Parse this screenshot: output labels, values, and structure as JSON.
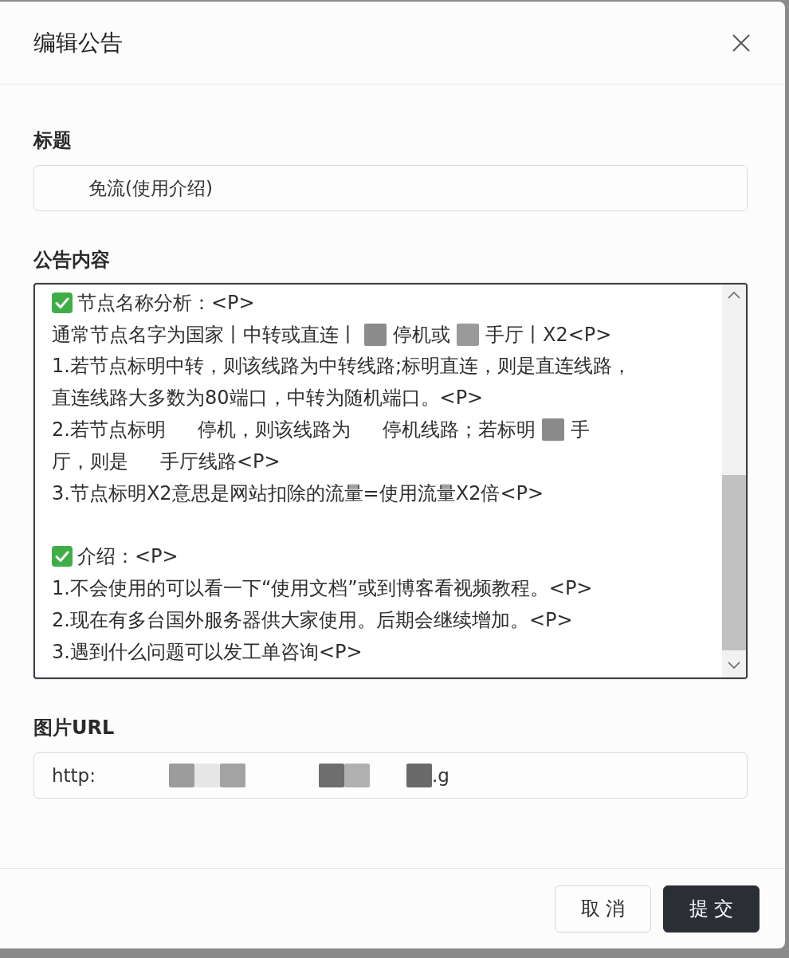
{
  "dialog": {
    "title": "编辑公告"
  },
  "fields": [
    {
      "kind": "input",
      "label": "标题",
      "segments": [
        {
          "kind": "gap"
        },
        {
          "kind": "text",
          "text": "免流(使用介绍)"
        }
      ]
    },
    {
      "kind": "textarea",
      "label": "公告内容",
      "focused": true,
      "lines": [
        {
          "kind": "heading",
          "segments": [
            {
              "kind": "text",
              "text": "节点名称分析：<P>"
            }
          ]
        },
        {
          "kind": "text",
          "segments": [
            {
              "kind": "text",
              "text": "通常节点名字为国家丨中转或直连丨"
            },
            {
              "kind": "redacted",
              "color": "#8c8c8c"
            },
            {
              "kind": "text",
              "text": "停机或"
            },
            {
              "kind": "redacted",
              "color": "#9a9a9a"
            },
            {
              "kind": "text",
              "text": "手厅丨X2<P>"
            }
          ]
        },
        {
          "kind": "text",
          "segments": [
            {
              "kind": "text",
              "text": "1.若节点标明中转，则该线路为中转线路;标明直连，则是直连线路，"
            }
          ]
        },
        {
          "kind": "text",
          "segments": [
            {
              "kind": "text",
              "text": "直连线路大多数为80端口，中转为随机端口。<P>"
            }
          ]
        },
        {
          "kind": "text",
          "segments": [
            {
              "kind": "text",
              "text": "2.若节点标明"
            },
            {
              "kind": "gap"
            },
            {
              "kind": "text",
              "text": "停机，则该线路为"
            },
            {
              "kind": "gap"
            },
            {
              "kind": "text",
              "text": "停机线路；若标明"
            },
            {
              "kind": "redacted",
              "color": "#8a8a8a"
            },
            {
              "kind": "text",
              "text": "手"
            }
          ]
        },
        {
          "kind": "text",
          "segments": [
            {
              "kind": "text",
              "text": "厅，则是"
            },
            {
              "kind": "gap"
            },
            {
              "kind": "text",
              "text": "手厅线路<P>"
            }
          ]
        },
        {
          "kind": "text",
          "segments": [
            {
              "kind": "text",
              "text": "3.节点标明X2意思是网站扣除的流量=使用流量X2倍<P>"
            }
          ]
        },
        {
          "kind": "blank"
        },
        {
          "kind": "heading",
          "segments": [
            {
              "kind": "text",
              "text": "介绍：<P>"
            }
          ]
        },
        {
          "kind": "text",
          "segments": [
            {
              "kind": "text",
              "text": "1.不会使用的可以看一下“使用文档”或到博客看视频教程。<P>"
            }
          ]
        },
        {
          "kind": "text",
          "segments": [
            {
              "kind": "text",
              "text": "2.现在有多台国外服务器供大家使用。后期会继续增加。<P>"
            }
          ]
        },
        {
          "kind": "text",
          "segments": [
            {
              "kind": "text",
              "text": "3.遇到什么问题可以发工单咨询<P>"
            }
          ]
        }
      ]
    },
    {
      "kind": "input",
      "label": "图片URL",
      "segments": [
        {
          "kind": "text",
          "text": "http:"
        },
        {
          "kind": "gap"
        },
        {
          "kind": "gap"
        },
        {
          "kind": "redacted",
          "color": "#9c9c9c"
        },
        {
          "kind": "redacted",
          "color": "#e6e6e6"
        },
        {
          "kind": "redacted",
          "color": "#a3a3a3"
        },
        {
          "kind": "gap"
        },
        {
          "kind": "gap"
        },
        {
          "kind": "redacted",
          "color": "#6e6e6e"
        },
        {
          "kind": "redacted",
          "color": "#b0b0b0"
        },
        {
          "kind": "gap"
        },
        {
          "kind": "redacted",
          "color": "#6a6a6a"
        },
        {
          "kind": "text",
          "text": ".g"
        }
      ]
    }
  ],
  "buttons": [
    {
      "kind": "secondary",
      "label": "取消"
    },
    {
      "kind": "primary",
      "label": "提交"
    }
  ]
}
